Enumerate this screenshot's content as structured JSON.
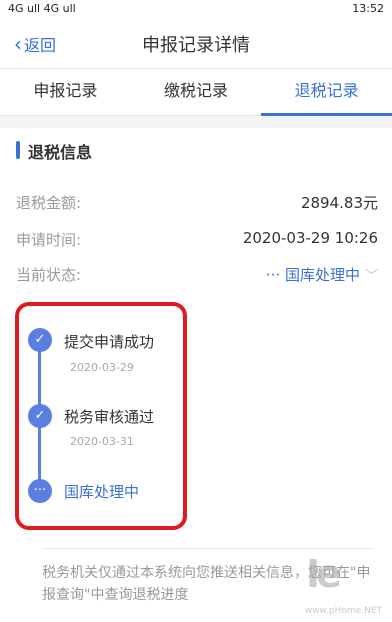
{
  "statusbar": {
    "left": "4G ull 4G ull",
    "right": "13:52"
  },
  "nav": {
    "back_label": "返回",
    "title": "申报记录详情"
  },
  "tabs": [
    {
      "label": "申报记录"
    },
    {
      "label": "缴税记录"
    },
    {
      "label": "退税记录"
    }
  ],
  "section": {
    "title": "退税信息"
  },
  "info": {
    "amount_label": "退税金额:",
    "amount_value": "2894.83元",
    "time_label": "申请时间:",
    "time_value": "2020-03-29 10:26",
    "status_label": "当前状态:",
    "status_value": "··· 国库处理中"
  },
  "timeline": [
    {
      "title": "提交申请成功",
      "date": "2020-03-29",
      "icon": "check-icon"
    },
    {
      "title": "税务审核通过",
      "date": "2020-03-31",
      "icon": "check-icon"
    },
    {
      "title": "国库处理中",
      "date": "",
      "icon": "ellipsis-icon"
    }
  ],
  "note": "税务机关仅通过本系统向您推送相关信息，您可在\"申报查询\"中查询退税进度",
  "colors": {
    "accent": "#3a6fd8",
    "highlight_border": "#e0191f",
    "node": "#5b7fe0"
  }
}
